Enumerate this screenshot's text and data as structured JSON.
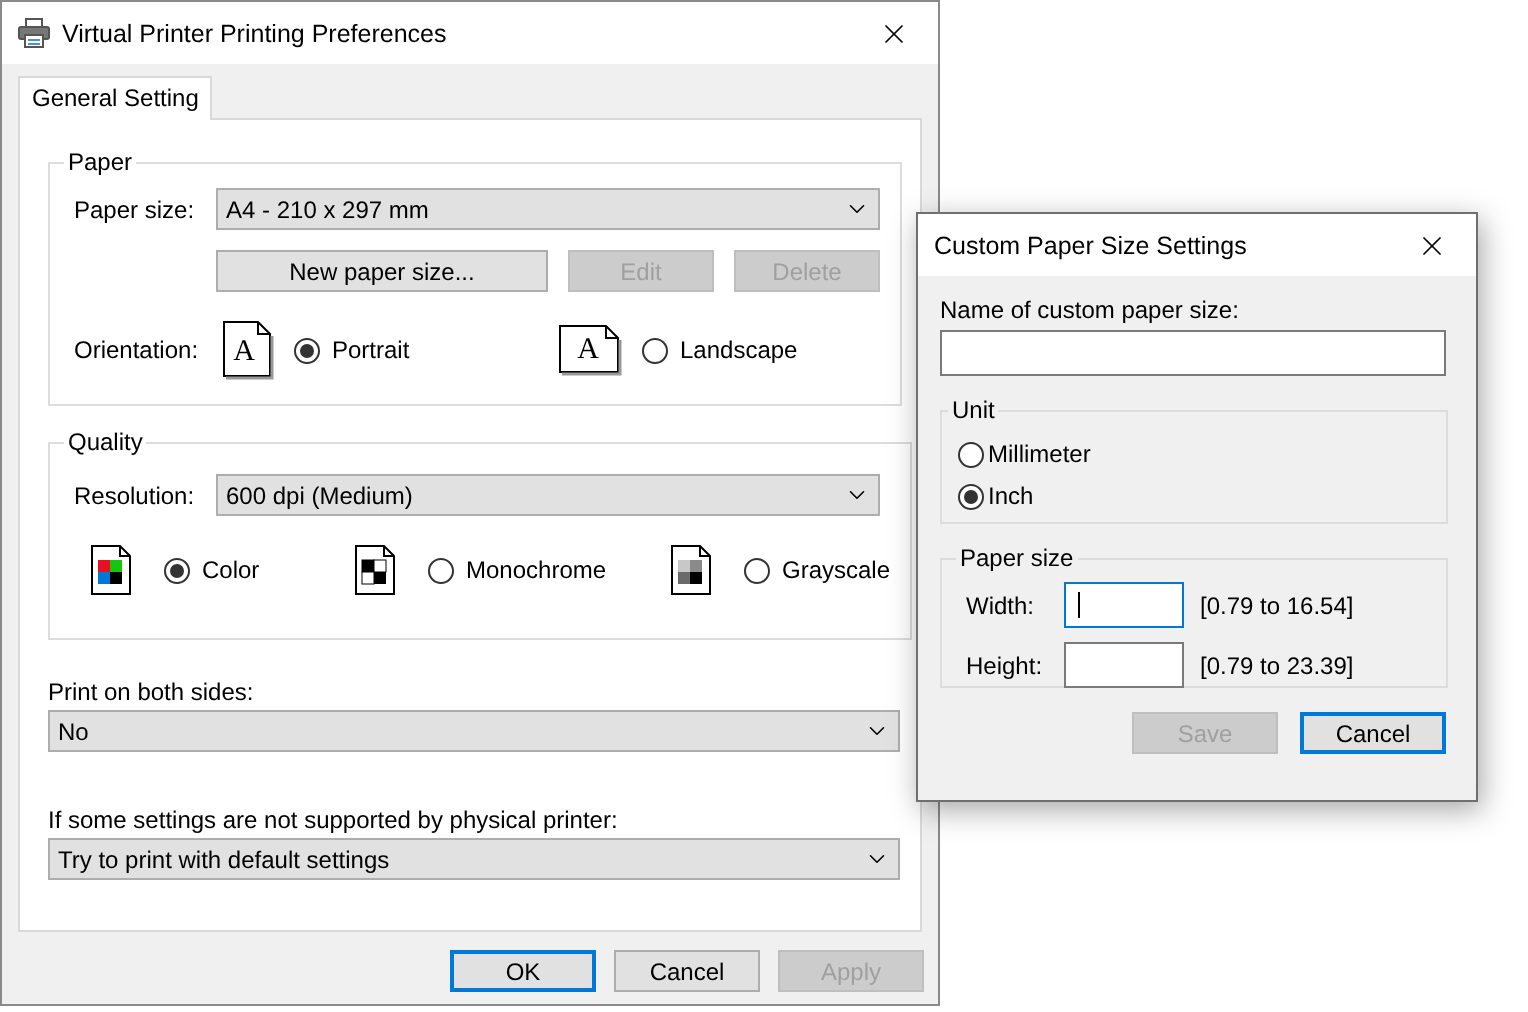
{
  "main_window": {
    "title": "Virtual Printer Printing Preferences",
    "tabs": [
      {
        "label": "General Setting",
        "selected": true
      }
    ],
    "paper": {
      "legend": "Paper",
      "paper_size_label": "Paper size:",
      "paper_size": "A4 - 210 x 297 mm",
      "buttons": [
        {
          "label": "New paper size...",
          "disabled": false
        },
        {
          "label": "Edit",
          "disabled": true
        },
        {
          "label": "Delete",
          "disabled": true
        }
      ],
      "orientation_label": "Orientation:",
      "orientations": [
        {
          "label": "Portrait",
          "kind": "portrait",
          "icon_letter": "A",
          "selected": true
        },
        {
          "label": "Landscape",
          "kind": "landscape",
          "icon_letter": "A",
          "selected": false
        }
      ]
    },
    "quality": {
      "legend": "Quality",
      "resolution_label": "Resolution:",
      "resolution": "600 dpi (Medium)",
      "modes": [
        {
          "label": "Color",
          "kind": "color",
          "selected": true
        },
        {
          "label": "Monochrome",
          "kind": "mono",
          "selected": false
        },
        {
          "label": "Grayscale",
          "kind": "gray",
          "selected": false
        }
      ]
    },
    "duplex": {
      "label": "Print on both sides:",
      "value": "No"
    },
    "fallback": {
      "label": "If some settings are not supported by physical printer:",
      "value": "Try to print with default settings"
    },
    "buttons": [
      {
        "label": "OK",
        "default": true,
        "disabled": false
      },
      {
        "label": "Cancel",
        "default": false,
        "disabled": false
      },
      {
        "label": "Apply",
        "default": false,
        "disabled": true
      }
    ]
  },
  "dialog": {
    "title": "Custom Paper Size Settings",
    "name_label": "Name of custom paper size:",
    "unit": {
      "legend": "Unit",
      "options": [
        {
          "label": "Millimeter",
          "selected": false
        },
        {
          "label": "Inch",
          "selected": true
        }
      ]
    },
    "paper_size": {
      "legend": "Paper size",
      "fields": [
        {
          "label": "Width:",
          "range": "[0.79 to 16.54]",
          "focused": true
        },
        {
          "label": "Height:",
          "range": "[0.79 to 23.39]",
          "focused": false
        }
      ]
    },
    "buttons": [
      {
        "label": "Save",
        "default": false,
        "disabled": true
      },
      {
        "label": "Cancel",
        "default": true,
        "disabled": false
      }
    ]
  }
}
